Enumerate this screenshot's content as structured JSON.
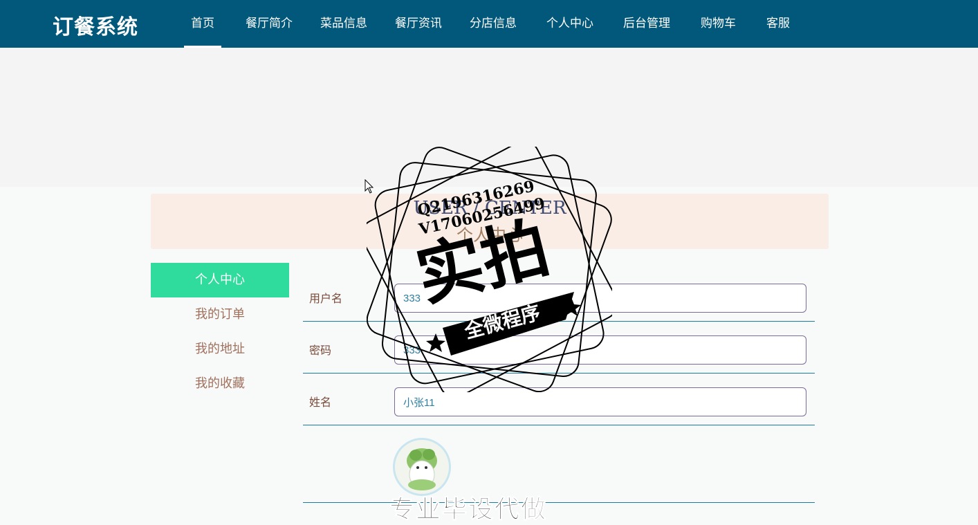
{
  "brand": "订餐系统",
  "nav": [
    {
      "label": "首页",
      "active": true
    },
    {
      "label": "餐厅简介"
    },
    {
      "label": "菜品信息"
    },
    {
      "label": "餐厅资讯"
    },
    {
      "label": "分店信息"
    },
    {
      "label": "个人中心"
    },
    {
      "label": "后台管理"
    },
    {
      "label": "购物车"
    },
    {
      "label": "客服"
    }
  ],
  "section": {
    "title_en": "USER / CENTER",
    "title_cn": "个人中心"
  },
  "sidebar": [
    {
      "label": "个人中心",
      "active": true
    },
    {
      "label": "我的订单"
    },
    {
      "label": "我的地址"
    },
    {
      "label": "我的收藏"
    }
  ],
  "form": {
    "username": {
      "label": "用户名",
      "value": "333"
    },
    "password": {
      "label": "密码",
      "value": "333"
    },
    "name": {
      "label": "姓名",
      "value": "小张11"
    }
  },
  "watermark": {
    "qq": "Q2196316269",
    "v": "V17060256499",
    "main": "实拍",
    "ribbon": "全微程序",
    "bottom": "专业毕设代做"
  },
  "colors": {
    "nav_bg": "#02587a",
    "sidebar_active": "#2fdb9d",
    "title_strip": "#f9ede5"
  }
}
